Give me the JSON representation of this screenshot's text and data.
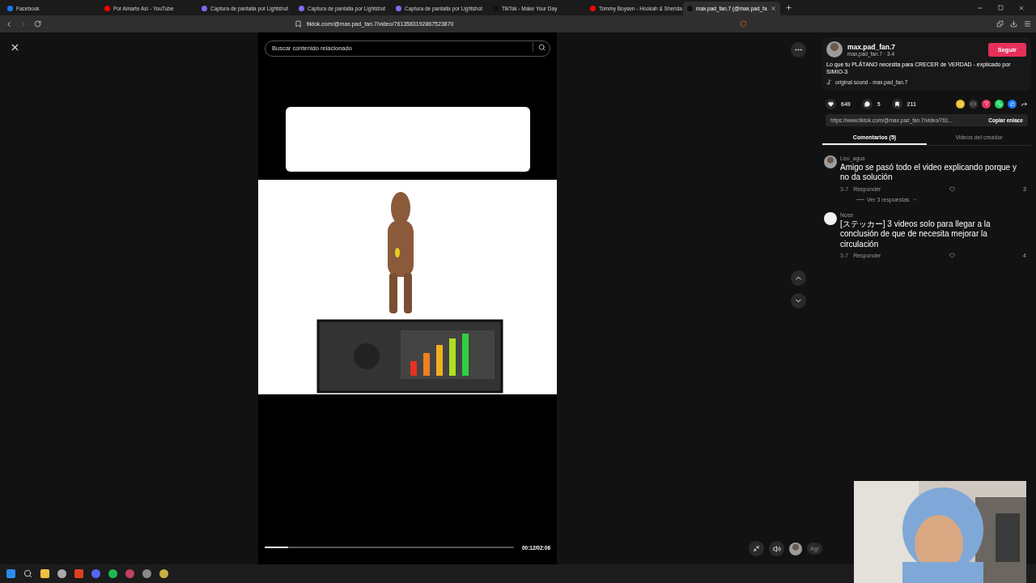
{
  "browser": {
    "tabs": [
      {
        "title": "Facebook",
        "selected": false
      },
      {
        "title": "Por Amarte Así - YouTube",
        "selected": false
      },
      {
        "title": "Captura de pantalla por Lightshot",
        "selected": false
      },
      {
        "title": "Captura de pantalla por Lightshot",
        "selected": false
      },
      {
        "title": "Captura de pantalla por Lightshot",
        "selected": false
      },
      {
        "title": "TikTok - Make Your Day",
        "selected": false
      },
      {
        "title": "Tommy Boysen - Hookah & Sherida",
        "selected": false
      },
      {
        "title": "max.pad_fan.7 (@max.pad_fa",
        "selected": true
      }
    ],
    "address": "tiktok.com/@max.pad_fan.7/video/7613583192867523870"
  },
  "video": {
    "search": {
      "placeholder": "Buscar contenido relacionado"
    },
    "progress": {
      "level": 0.095
    },
    "time": "00:12/02:06",
    "cut_label": "Agr"
  },
  "details": {
    "author": "max.pad_fan.7",
    "handle": "max.pad_fan.7 · 3-4",
    "follow": "Seguir",
    "caption": "Lo que tu PLÁTANO necesita para CRECER de VERDAD - explicado por SIMIO-3",
    "sound": "original sound - max.pad_fan.7",
    "stats": {
      "likes": "649",
      "comments": "5",
      "saves": "211"
    },
    "link": {
      "url": "https://www.tiktok.com/@max.pad_fan.7/video/761...",
      "copy": "Copiar enlace"
    },
    "tabs": [
      {
        "label": "Comentarios (5)",
        "selected": true
      },
      {
        "label": "Videos del creador",
        "selected": false
      }
    ],
    "comments": [
      {
        "user": "Leo_agus",
        "text": "Amigo se pasó todo el video explicando porque y no da solución",
        "date": "3-7",
        "reply": "Responder",
        "likes": "3",
        "replies": "Ver 3 respuestas"
      },
      {
        "user": "Nose",
        "text": "[ステッカー] 3 videos solo para llegar a la conclusión de que de necesita mejorar la circulación",
        "date": "3-7",
        "reply": "Responder",
        "likes": "4"
      }
    ]
  }
}
